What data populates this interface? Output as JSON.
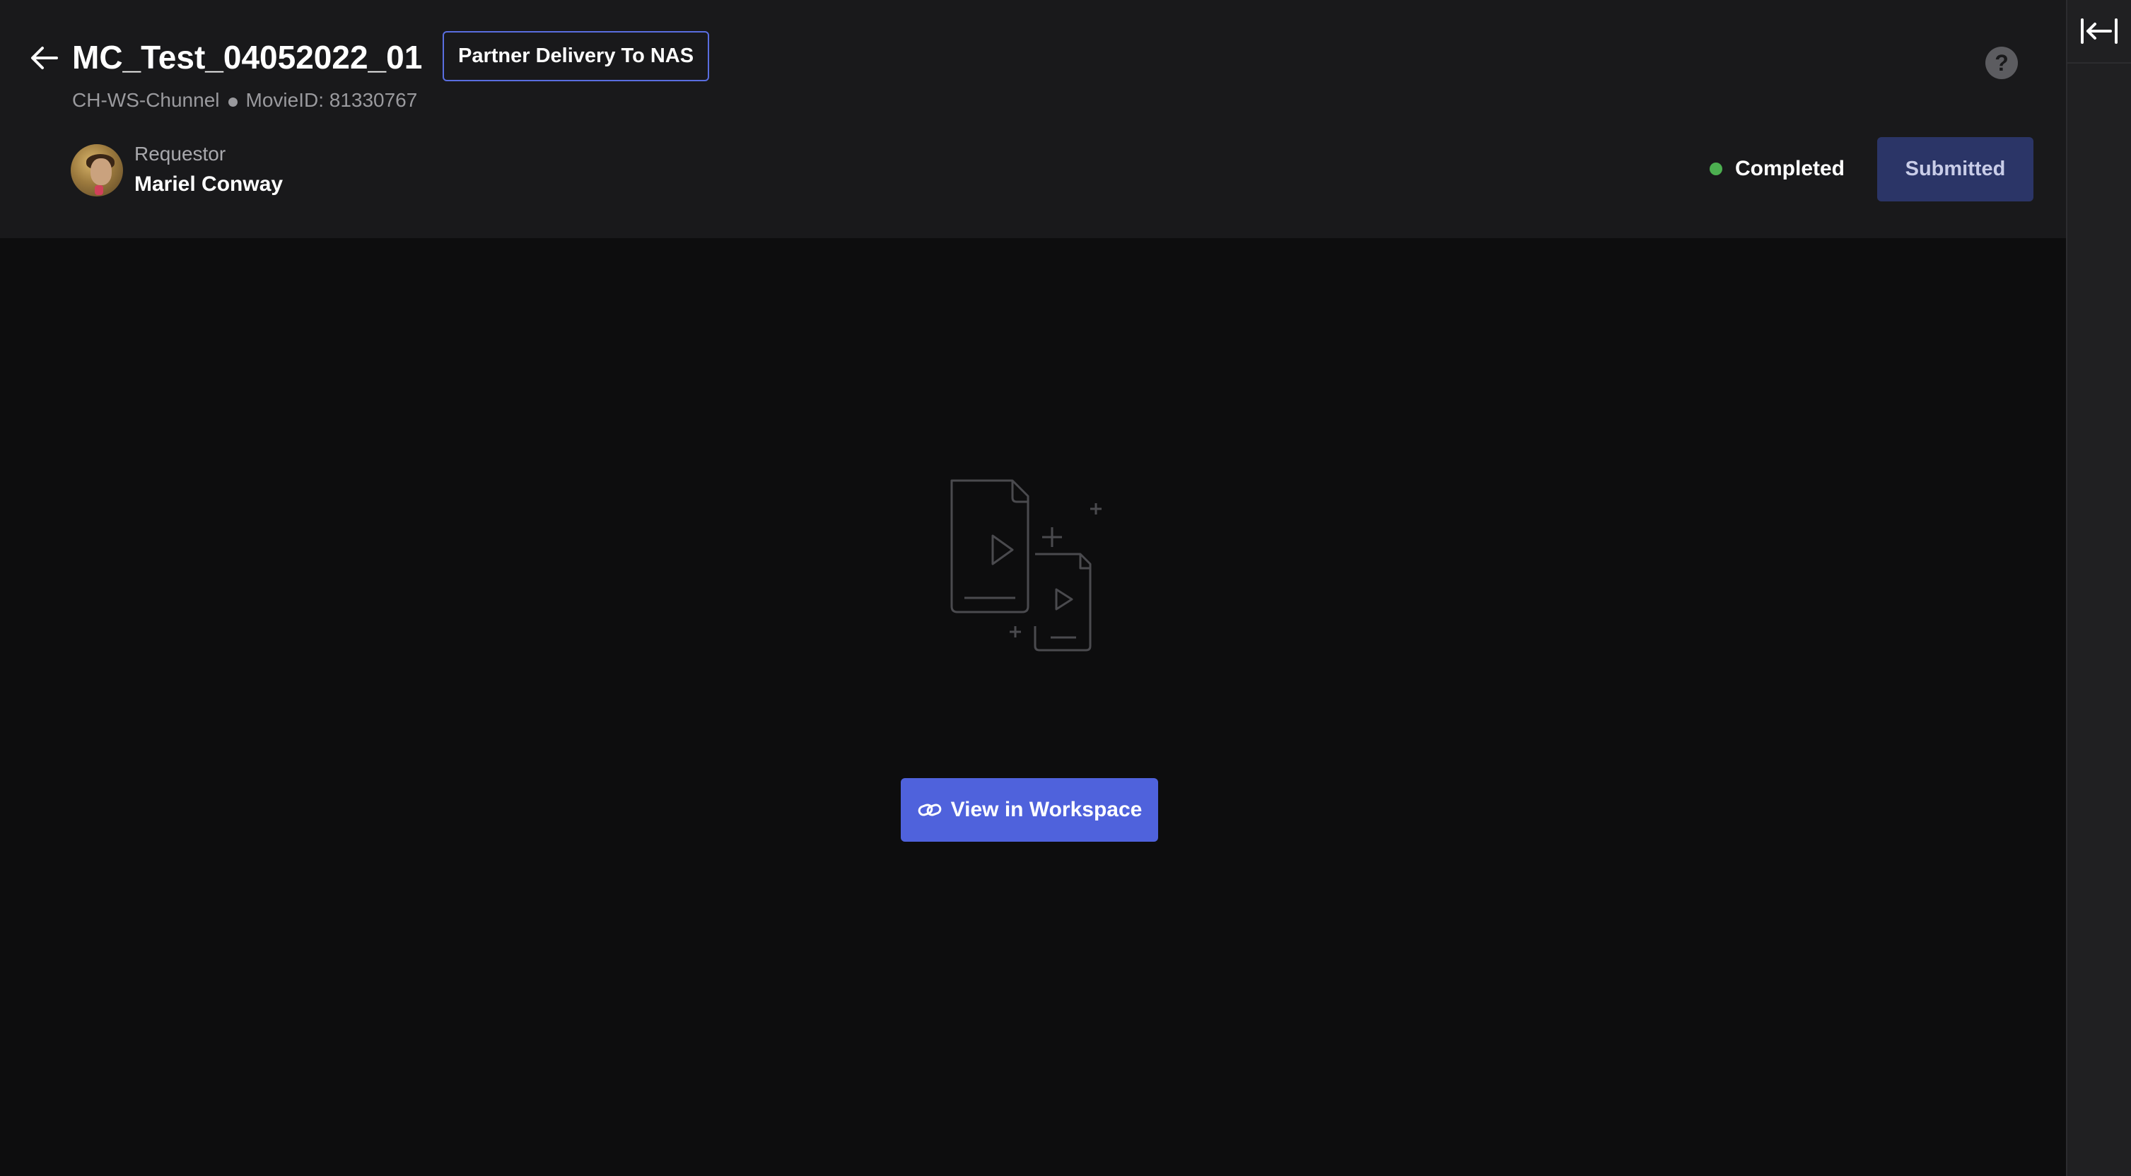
{
  "header": {
    "title": "MC_Test_04052022_01",
    "tag": "Partner Delivery To NAS",
    "channel": "CH-WS-Chunnel",
    "movie_id": "MovieID: 81330767",
    "help_label": "?"
  },
  "requestor": {
    "label": "Requestor",
    "name": "Mariel Conway"
  },
  "status": {
    "label": "Completed",
    "color": "#4caf50"
  },
  "actions": {
    "submitted_label": "Submitted",
    "view_workspace_label": "View in Workspace"
  },
  "icons": {
    "back": "arrow-left-icon",
    "help": "question-circle-icon",
    "collapse": "collapse-panel-icon",
    "empty_state": "video-files-illustration",
    "link": "link-icon"
  },
  "colors": {
    "accent": "#4f62dc",
    "submitted_bg": "#2b3567",
    "header_bg": "#19191b",
    "page_bg": "#0d0d0e"
  }
}
